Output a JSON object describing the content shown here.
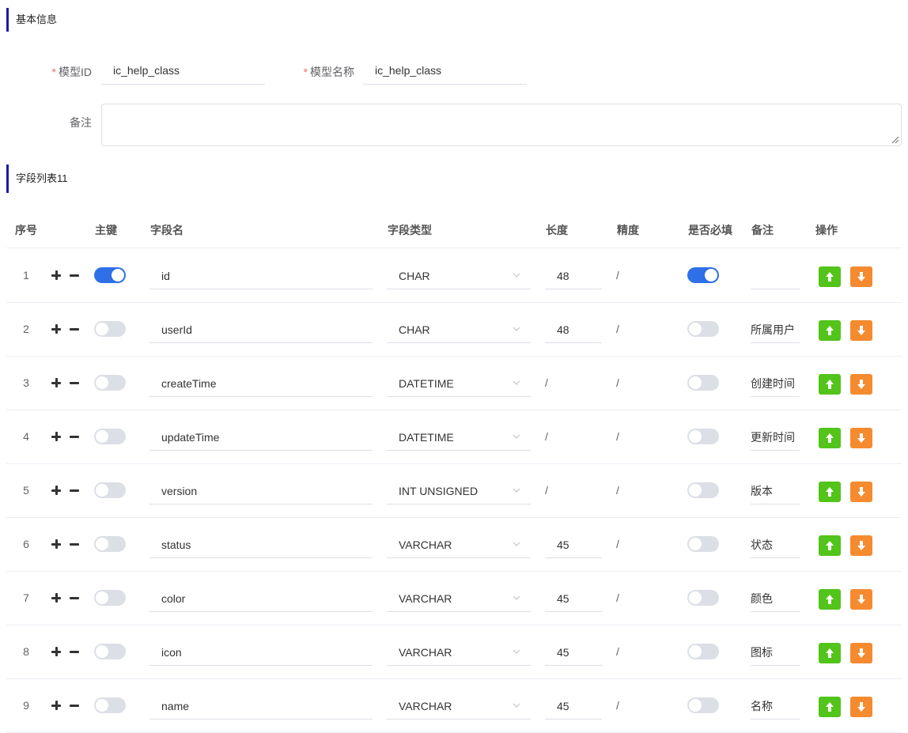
{
  "basic_info": {
    "section_title": "基本信息",
    "model_id_label": "模型ID",
    "model_id_value": "ic_help_class",
    "model_name_label": "模型名称",
    "model_name_value": "ic_help_class",
    "remark_label": "备注",
    "remark_value": ""
  },
  "field_list": {
    "section_title": "字段列表11",
    "columns": [
      "序号",
      "主键",
      "字段名",
      "字段类型",
      "长度",
      "精度",
      "是否必填",
      "备注",
      "操作"
    ],
    "rows": [
      {
        "index": "1",
        "primary_key": true,
        "name": "id",
        "type": "CHAR",
        "length": "48",
        "precision": "/",
        "required": true,
        "remark": ""
      },
      {
        "index": "2",
        "primary_key": false,
        "name": "userId",
        "type": "CHAR",
        "length": "48",
        "precision": "/",
        "required": false,
        "remark": "所属用户"
      },
      {
        "index": "3",
        "primary_key": false,
        "name": "createTime",
        "type": "DATETIME",
        "length": "/",
        "precision": "/",
        "required": false,
        "remark": "创建时间"
      },
      {
        "index": "4",
        "primary_key": false,
        "name": "updateTime",
        "type": "DATETIME",
        "length": "/",
        "precision": "/",
        "required": false,
        "remark": "更新时间"
      },
      {
        "index": "5",
        "primary_key": false,
        "name": "version",
        "type": "INT UNSIGNED",
        "length": "/",
        "precision": "/",
        "required": false,
        "remark": "版本"
      },
      {
        "index": "6",
        "primary_key": false,
        "name": "status",
        "type": "VARCHAR",
        "length": "45",
        "precision": "/",
        "required": false,
        "remark": "状态"
      },
      {
        "index": "7",
        "primary_key": false,
        "name": "color",
        "type": "VARCHAR",
        "length": "45",
        "precision": "/",
        "required": false,
        "remark": "颜色"
      },
      {
        "index": "8",
        "primary_key": false,
        "name": "icon",
        "type": "VARCHAR",
        "length": "45",
        "precision": "/",
        "required": false,
        "remark": "图标"
      },
      {
        "index": "9",
        "primary_key": false,
        "name": "name",
        "type": "VARCHAR",
        "length": "45",
        "precision": "/",
        "required": false,
        "remark": "名称"
      }
    ]
  },
  "colors": {
    "accent_bar": "#1a1aa6",
    "switch_on": "#2f6fe8",
    "move_up_button": "#52c41a",
    "move_down_button": "#f58a2f",
    "required_asterisk": "#f56c6c"
  },
  "icons": {
    "add_row": "plus-icon",
    "remove_row": "minus-icon",
    "type_dropdown": "chevron-down-icon",
    "move_up": "arrow-up-icon",
    "move_down": "arrow-down-icon"
  }
}
